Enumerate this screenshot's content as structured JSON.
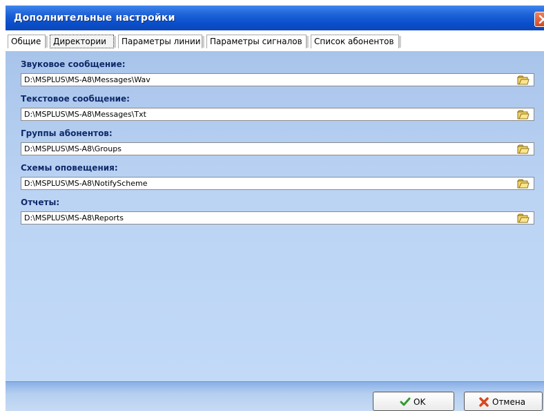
{
  "window": {
    "title": "Дополнительные настройки"
  },
  "tabs": [
    {
      "label": "Общие"
    },
    {
      "label": "Директории",
      "active": true
    },
    {
      "label": "Параметры линии"
    },
    {
      "label": "Параметры сигналов"
    },
    {
      "label": "Список абонентов"
    }
  ],
  "fields": [
    {
      "label": "Звуковое сообщение:",
      "value": "D:\\MSPLUS\\MS-A8\\Messages\\Wav"
    },
    {
      "label": "Текстовое сообщение:",
      "value": "D:\\MSPLUS\\MS-A8\\Messages\\Txt"
    },
    {
      "label": "Группы абонентов:",
      "value": "D:\\MSPLUS\\MS-A8\\Groups"
    },
    {
      "label": "Схемы оповещения:",
      "value": "D:\\MSPLUS\\MS-A8\\NotifyScheme"
    },
    {
      "label": "Отчеты:",
      "value": "D:\\MSPLUS\\MS-A8\\Reports"
    }
  ],
  "buttons": {
    "ok_label": "OK",
    "cancel_label": "Отмена"
  },
  "colors": {
    "title_bar": "#0a4fcc",
    "content_bg": "#bcd4f4",
    "label_text": "#0f2a6a",
    "close_button": "#d24a22"
  },
  "icons": {
    "close": "close-icon",
    "browse": "folder-icon",
    "ok": "checkmark-icon",
    "cancel": "cross-icon"
  }
}
